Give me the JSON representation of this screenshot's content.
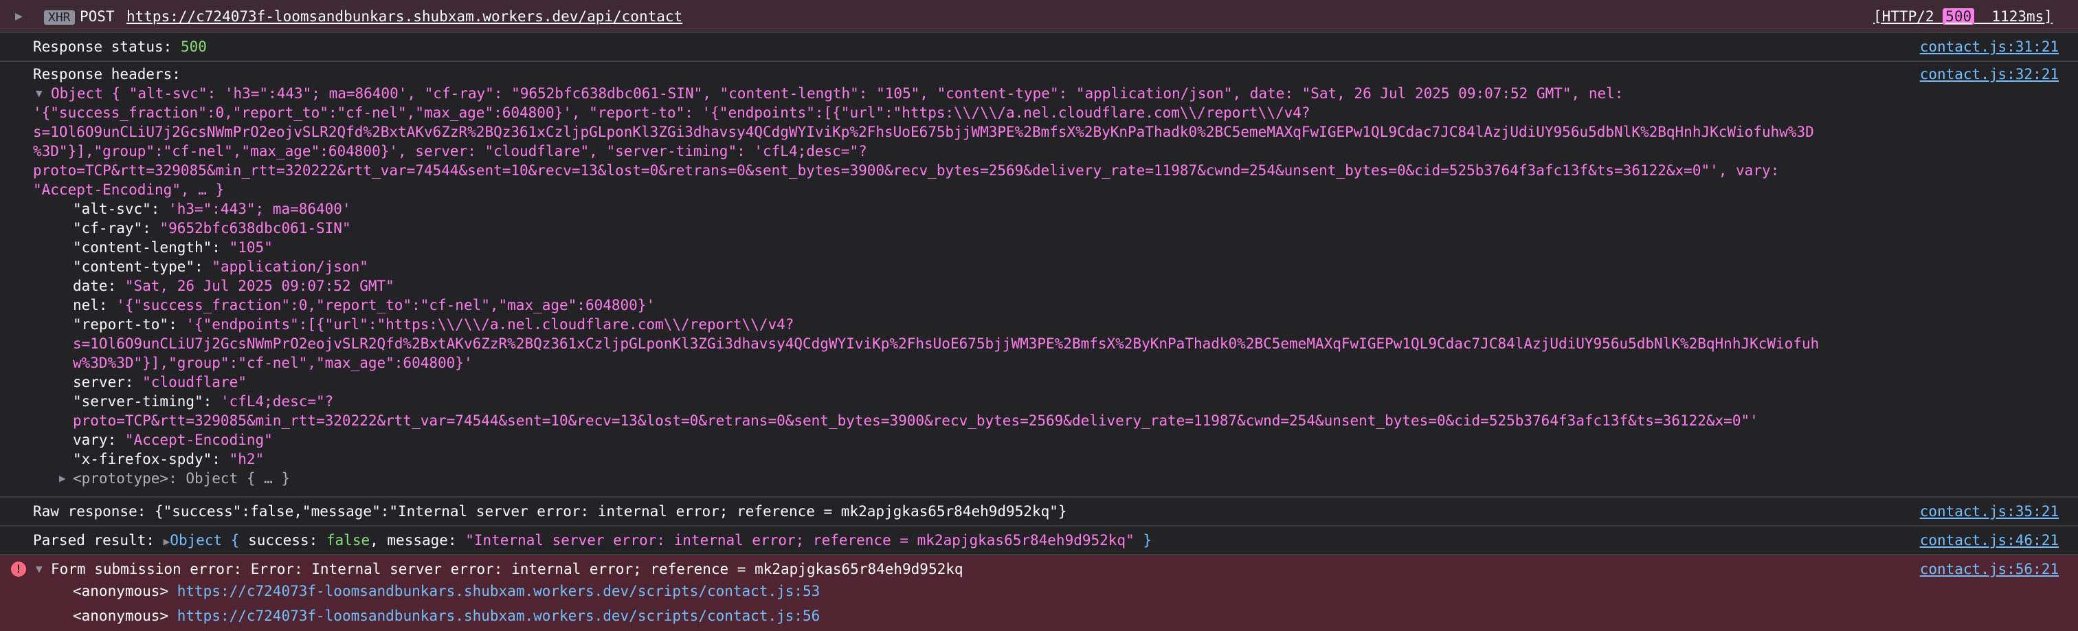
{
  "xhr": {
    "label": "XHR",
    "method": "POST",
    "url": "https://c724073f-loomsandbunkars.shubxam.workers.dev/api/contact",
    "http_version": "[HTTP/2",
    "status": "500",
    "time": "1123ms]"
  },
  "response_status": {
    "prefix": "Response status: ",
    "value": "500",
    "source": "contact.js:31:21"
  },
  "response_headers": {
    "label": "Response headers:",
    "source": "contact.js:32:21",
    "summary_lines": [
      "Object { \"alt-svc\": 'h3=\":443\"; ma=86400', \"cf-ray\": \"9652bfc638dbc061-SIN\", \"content-length\": \"105\", \"content-type\": \"application/json\", date: \"Sat, 26 Jul 2025 09:07:52 GMT\", nel:",
      "'{\"success_fraction\":0,\"report_to\":\"cf-nel\",\"max_age\":604800}', \"report-to\": '{\"endpoints\":[{\"url\":\"https:\\\\/\\\\/a.nel.cloudflare.com\\\\/report\\\\/v4?",
      "s=1Ol6O9unCLiU7j2GcsNWmPrO2eojvSLR2Qfd%2BxtAKv6ZzR%2BQz361xCzljpGLponKl3ZGi3dhavsy4QCdgWYIviKp%2FhsUoE675bjjWM3PE%2BmfsX%2ByKnPaThadk0%2BC5emeMAXqFwIGEPw1QL9Cdac7JC84lAzjUdiUY956u5dbNlK%2BqHnhJKcWiofuhw%3D",
      "%3D\"}],\"group\":\"cf-nel\",\"max_age\":604800}', server: \"cloudflare\", \"server-timing\": 'cfL4;desc=\"?",
      "proto=TCP&rtt=329085&min_rtt=320222&rtt_var=74544&sent=10&recv=13&lost=0&retrans=0&sent_bytes=3900&recv_bytes=2569&delivery_rate=11987&cwnd=254&unsent_bytes=0&cid=525b3764f3afc13f&ts=36122&x=0\"', vary:",
      "\"Accept-Encoding\", … }"
    ],
    "entries": [
      {
        "key": "\"alt-svc\": ",
        "value": "'h3=\":443\"; ma=86400'"
      },
      {
        "key": "\"cf-ray\": ",
        "value": "\"9652bfc638dbc061-SIN\""
      },
      {
        "key": "\"content-length\": ",
        "value": "\"105\""
      },
      {
        "key": "\"content-type\": ",
        "value": "\"application/json\""
      },
      {
        "key": "date: ",
        "value": "\"Sat, 26 Jul 2025 09:07:52 GMT\""
      },
      {
        "key": "nel: ",
        "value": "'{\"success_fraction\":0,\"report_to\":\"cf-nel\",\"max_age\":604800}'"
      },
      {
        "key": "\"report-to\": ",
        "value": "'{\"endpoints\":[{\"url\":\"https:\\\\/\\\\/a.nel.cloudflare.com\\\\/report\\\\/v4?"
      },
      {
        "key": "",
        "value": "s=1Ol6O9unCLiU7j2GcsNWmPrO2eojvSLR2Qfd%2BxtAKv6ZzR%2BQz361xCzljpGLponKl3ZGi3dhavsy4QCdgWYIviKp%2FhsUoE675bjjWM3PE%2BmfsX%2ByKnPaThadk0%2BC5emeMAXqFwIGEPw1QL9Cdac7JC84lAzjUdiUY956u5dbNlK%2BqHnhJKcWiofuh"
      },
      {
        "key": "",
        "value": "w%3D%3D\"}],\"group\":\"cf-nel\",\"max_age\":604800}'"
      },
      {
        "key": "server: ",
        "value": "\"cloudflare\""
      },
      {
        "key": "\"server-timing\": ",
        "value": "'cfL4;desc=\"?"
      },
      {
        "key": "",
        "value": "proto=TCP&rtt=329085&min_rtt=320222&rtt_var=74544&sent=10&recv=13&lost=0&retrans=0&sent_bytes=3900&recv_bytes=2569&delivery_rate=11987&cwnd=254&unsent_bytes=0&cid=525b3764f3afc13f&ts=36122&x=0\"'"
      },
      {
        "key": "vary: ",
        "value": "\"Accept-Encoding\""
      },
      {
        "key": "\"x-firefox-spdy\": ",
        "value": "\"h2\""
      }
    ],
    "prototype": "<prototype>: Object { … }"
  },
  "raw_response": {
    "text": "Raw response: {\"success\":false,\"message\":\"Internal server error: internal error; reference = mk2apjgkas65r84eh9d952kq\"}",
    "source": "contact.js:35:21"
  },
  "parsed_result": {
    "prefix": "Parsed result: ",
    "object_label": "Object",
    "open": " { ",
    "success_key": "success: ",
    "success_value": "false",
    "sep": ", ",
    "message_key": "message: ",
    "message_value": "\"Internal server error: internal error; reference = mk2apjgkas65r84eh9d952kq\"",
    "close": " }",
    "source": "contact.js:46:21"
  },
  "error": {
    "icon_glyph": "!",
    "message": "Form submission error: Error: Internal server error: internal error; reference = mk2apjgkas65r84eh9d952kq",
    "source": "contact.js:56:21",
    "stack": [
      {
        "fn": "<anonymous>",
        "url": "https://c724073f-loomsandbunkars.shubxam.workers.dev/scripts/contact.js:53"
      },
      {
        "fn": "<anonymous>",
        "url": "https://c724073f-loomsandbunkars.shubxam.workers.dev/scripts/contact.js:56"
      }
    ]
  },
  "colors": {
    "background": "#232327",
    "string": "#ff7de9",
    "number": "#86de74",
    "link": "#75bfff",
    "error_bg": "#4e2531",
    "xhr_bg": "#3d2a33"
  }
}
